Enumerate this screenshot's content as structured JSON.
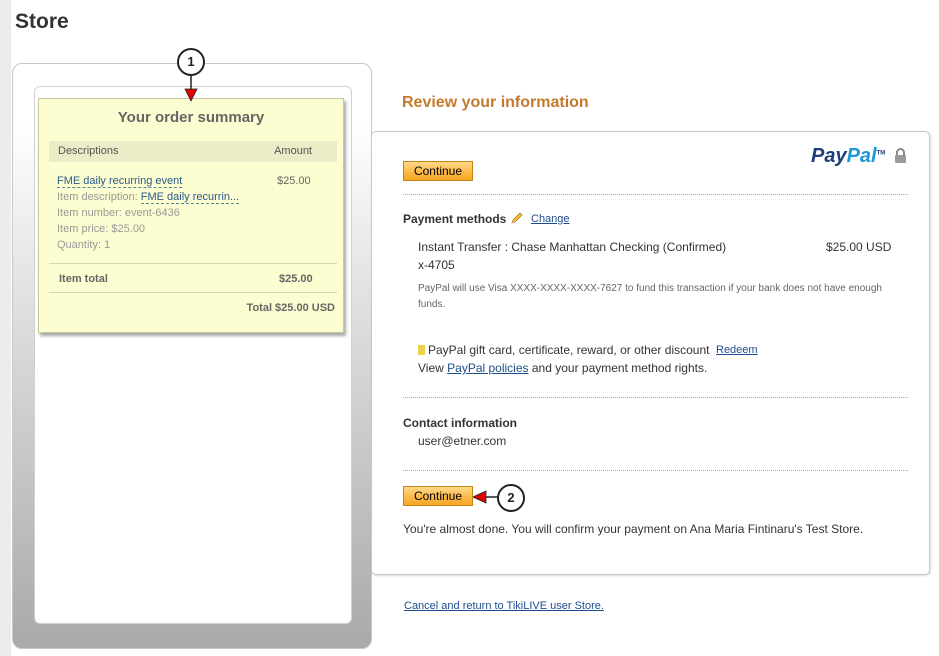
{
  "page": {
    "title": "Store"
  },
  "order_summary": {
    "title": "Your order summary",
    "columns": {
      "description": "Descriptions",
      "amount": "Amount"
    },
    "item": {
      "name": "FME daily recurring event",
      "amount": "$25.00",
      "description_label": "Item description:",
      "description_value": "FME daily recurrin...",
      "number": "Item number: event-6436",
      "price": "Item price: $25.00",
      "quantity": "Quantity: 1"
    },
    "item_total_label": "Item total",
    "item_total_value": "$25.00",
    "grand_total": "Total $25.00 USD"
  },
  "callouts": {
    "one": "1",
    "two": "2"
  },
  "review": {
    "title": "Review your information",
    "continue_label": "Continue",
    "paypal_logo": {
      "pay": "Pay",
      "pal": "Pal",
      "tm": "TM"
    },
    "payment_methods_label": "Payment methods",
    "change_link": "Change",
    "transfer_text": "Instant Transfer : Chase Manhattan Checking (Confirmed)",
    "transfer_amount": "$25.00 USD",
    "account_suffix": "x-4705",
    "funding_note": "PayPal will use Visa XXXX-XXXX-XXXX-7627 to fund this transaction if your bank does not have enough funds.",
    "gift_text": "PayPal gift card, certificate, reward, or other discount",
    "redeem_link": "Redeem",
    "view_prefix": "View",
    "policies_link": "PayPal policies",
    "view_suffix": "and your payment method rights.",
    "contact_label": "Contact information",
    "contact_email": "user@etner.com",
    "almost_done": "You're almost done. You will confirm your payment on Ana Maria Fintinaru's Test Store."
  },
  "cancel_link": "Cancel and return to TikiLIVE user Store.",
  "colors": {
    "accent_orange": "#c47a2c",
    "button": "#fdb94a",
    "link": "#1e4c8a",
    "callout_arrow": "#e00000"
  }
}
